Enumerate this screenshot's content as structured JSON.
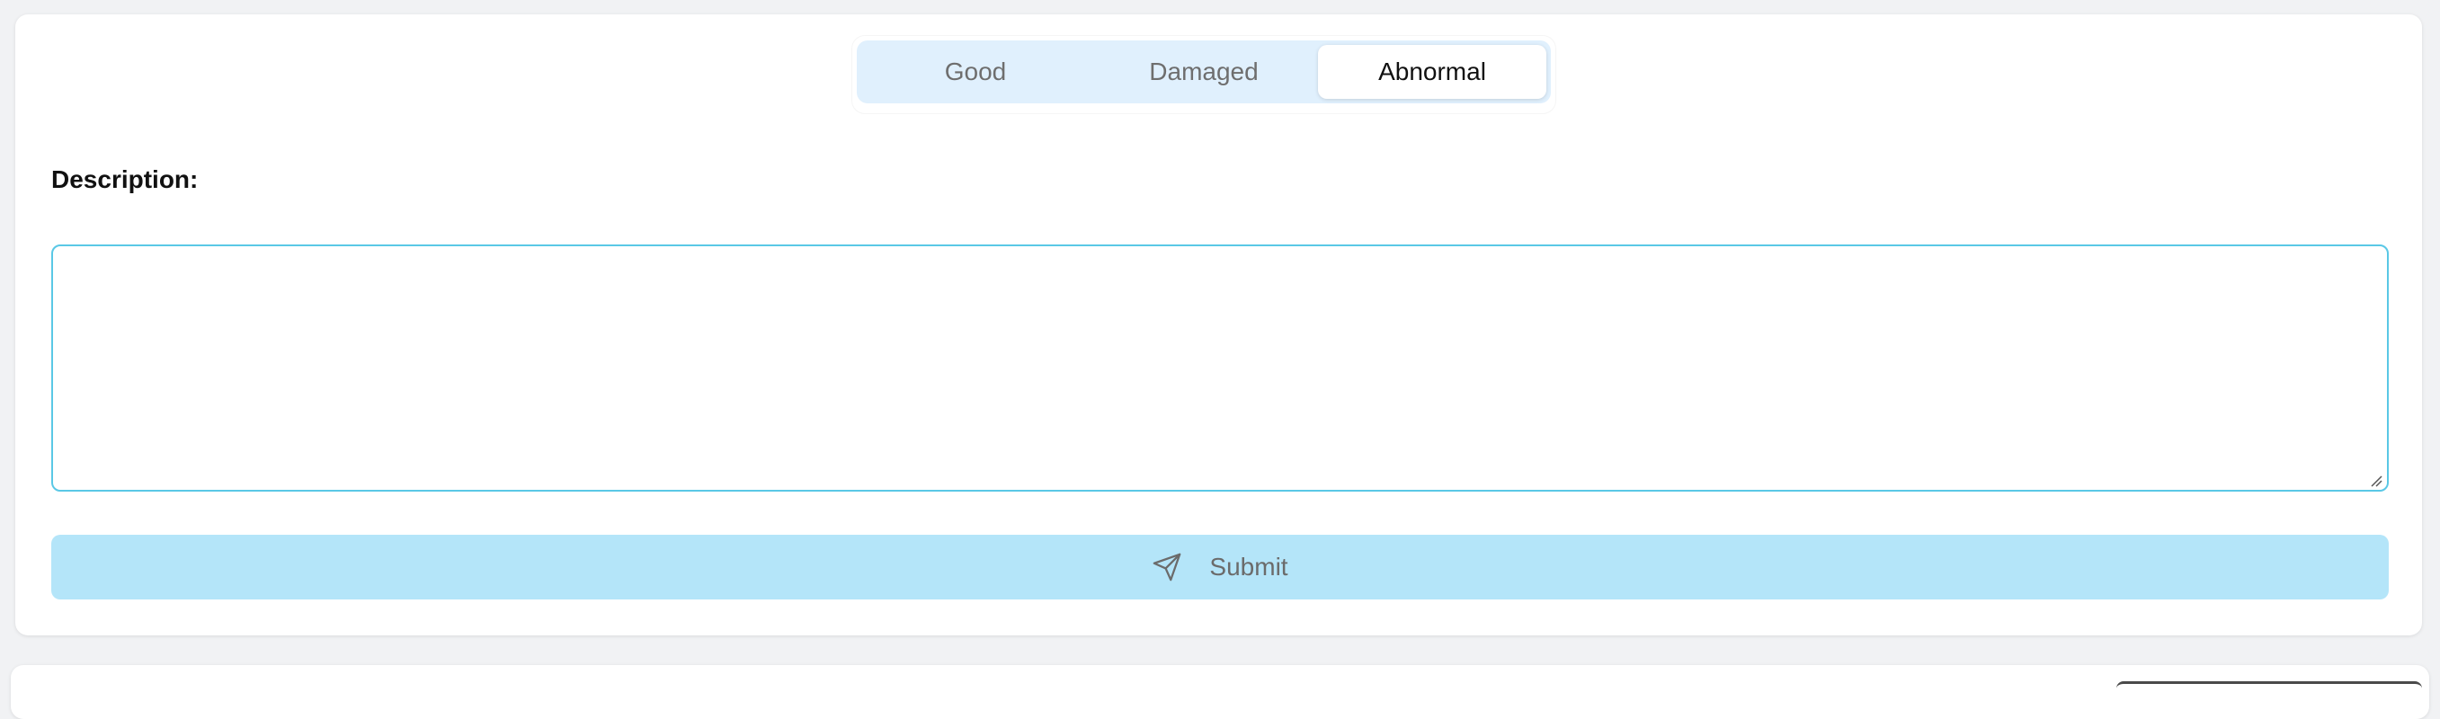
{
  "status_selector": {
    "options": [
      {
        "label": "Good",
        "selected": false
      },
      {
        "label": "Damaged",
        "selected": false
      },
      {
        "label": "Abnormal",
        "selected": true
      }
    ]
  },
  "form": {
    "description_label": "Description:",
    "description_value": "",
    "submit_label": "Submit",
    "submit_icon": "send-icon"
  },
  "colors": {
    "selector_track": "#e0f0fd",
    "textarea_border": "#5ac8e6",
    "submit_background": "#b4e5f9"
  }
}
